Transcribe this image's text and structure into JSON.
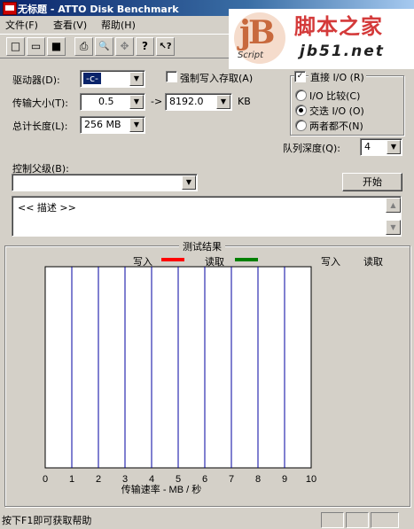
{
  "window": {
    "title": "无标题 - ATTO Disk Benchmark"
  },
  "watermark": {
    "logo": "jB",
    "script": "Script",
    "cn": "脚本之家",
    "url": "jb51.net"
  },
  "menu": [
    {
      "label": "文件(F)"
    },
    {
      "label": "查看(V)"
    },
    {
      "label": "帮助(H)"
    }
  ],
  "toolbar": [
    {
      "icon": "new-icon",
      "glyph": "□"
    },
    {
      "icon": "open-icon",
      "glyph": "▭"
    },
    {
      "icon": "save-icon",
      "glyph": "■"
    },
    {
      "icon": "print-icon",
      "glyph": "⎙"
    },
    {
      "icon": "print-preview-icon",
      "glyph": "🔍"
    },
    {
      "icon": "move-icon",
      "glyph": "✥"
    },
    {
      "icon": "about-icon",
      "glyph": "?"
    },
    {
      "icon": "context-help-icon",
      "glyph": "↖?"
    }
  ],
  "settings": {
    "drive_label": "驱动器(D):",
    "drive_value": "-c-",
    "force_write_label": "强制写入存取(A)",
    "force_write_checked": false,
    "transfer_size_label": "传输大小(T):",
    "transfer_from": "0.5",
    "transfer_to_sep": "->",
    "transfer_to": "8192.0",
    "transfer_unit": "KB",
    "total_length_label": "总计长度(L):",
    "total_length_value": "256 MB",
    "direct_io_label": "直接 I/O (R)",
    "direct_io_checked": true,
    "io_compare_label": "I/O 比较(C)",
    "overlapped_io_label": "交迭 I/O (O)",
    "neither_label": "两者都不(N)",
    "selected_mode": "overlapped",
    "queue_depth_label": "队列深度(Q):",
    "queue_depth_value": "4",
    "control_file_label": "控制父级(B):",
    "control_file_value": "",
    "start_button": "开始",
    "description_text": "<< 描述 >>"
  },
  "results": {
    "group_title": "测试结果",
    "legend_write": "写入",
    "legend_read": "读取",
    "col_write": "写入",
    "col_read": "读取",
    "write_color": "#ff0000",
    "read_color": "#008000",
    "grid_line_color": "#0000a0"
  },
  "chart_data": {
    "type": "bar",
    "orientation": "horizontal",
    "xlabel": "传输速率 - MB / 秒",
    "xlim": [
      0,
      10
    ],
    "xticks": [
      "0",
      "1",
      "2",
      "3",
      "4",
      "5",
      "6",
      "7",
      "8",
      "9",
      "10"
    ],
    "series": [
      {
        "name": "写入",
        "values": []
      },
      {
        "name": "读取",
        "values": []
      }
    ]
  },
  "status": {
    "text": "按下F1即可获取帮助"
  }
}
